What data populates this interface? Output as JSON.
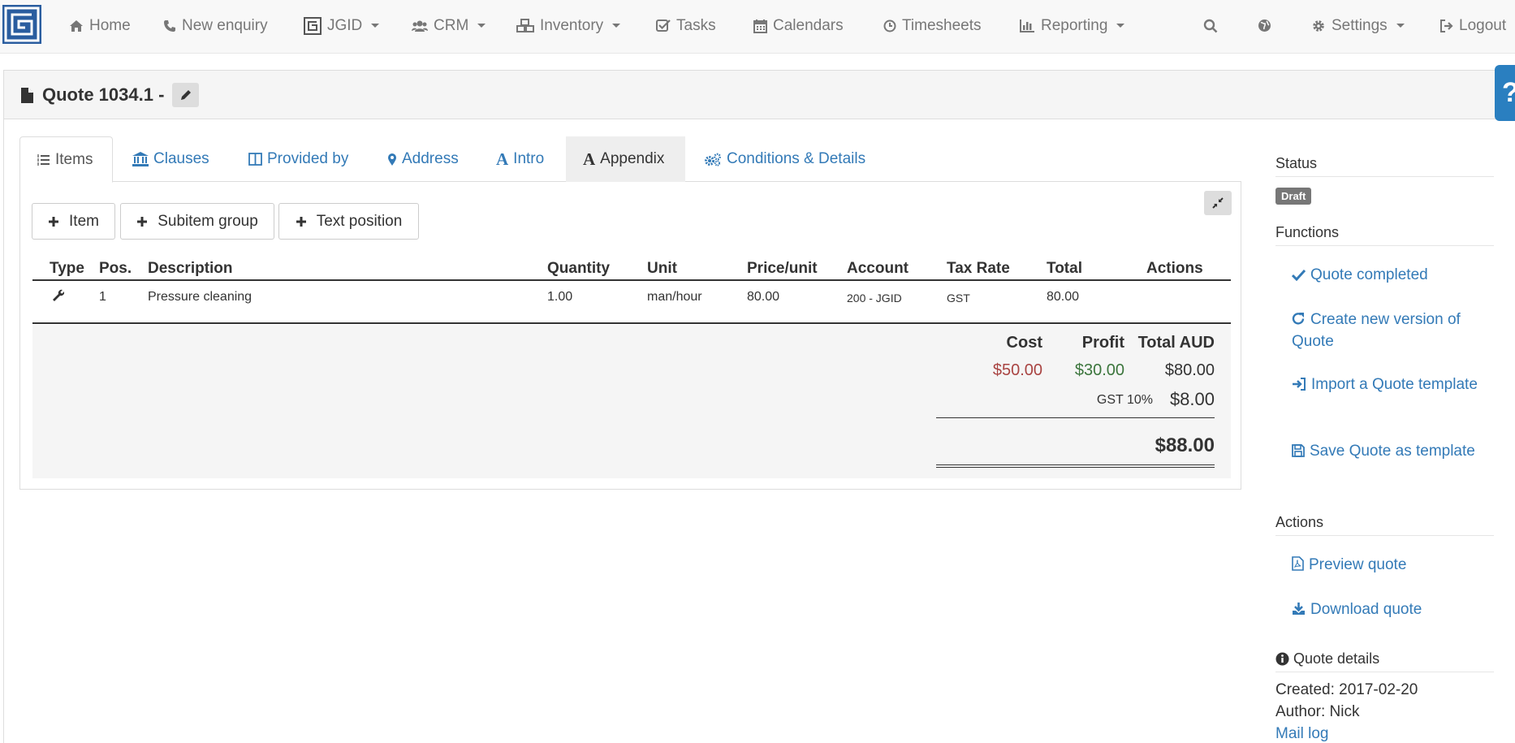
{
  "nav": {
    "home": "Home",
    "new_enquiry": "New enquiry",
    "jgid": "JGID",
    "crm": "CRM",
    "inventory": "Inventory",
    "tasks": "Tasks",
    "calendars": "Calendars",
    "timesheets": "Timesheets",
    "reporting": "Reporting",
    "settings": "Settings",
    "logout": "Logout"
  },
  "page": {
    "title": "Quote 1034.1 -",
    "help_glyph": "?"
  },
  "tabs": [
    "Items",
    "Clauses",
    "Provided by",
    "Address",
    "Intro",
    "Appendix",
    "Conditions & Details"
  ],
  "buttons": {
    "item": "Item",
    "subitem_group": "Subitem group",
    "text_position": "Text position"
  },
  "table": {
    "headers": [
      "Type",
      "Pos.",
      "Description",
      "Quantity",
      "Unit",
      "Price/unit",
      "Account",
      "Tax Rate",
      "Total",
      "Actions"
    ],
    "rows": [
      {
        "type_icon": "wrench-icon",
        "pos": "1",
        "description": "Pressure cleaning",
        "quantity": "1.00",
        "unit": "man/hour",
        "price_unit": "80.00",
        "account": "200 - JGID",
        "tax_rate": "GST",
        "total": "80.00"
      }
    ]
  },
  "totals": {
    "cost_label": "Cost",
    "profit_label": "Profit",
    "total_label": "Total AUD",
    "cost": "$50.00",
    "profit": "$30.00",
    "total": "$80.00",
    "gst_label": "GST 10%",
    "gst": "$8.00",
    "grand_total": "$88.00",
    "cost_color": "#a94442",
    "profit_color": "#3c763d"
  },
  "sidebar": {
    "status_heading": "Status",
    "status_badge": "Draft",
    "functions_heading": "Functions",
    "functions": [
      "Quote completed",
      "Create new version of Quote",
      "Import a Quote template",
      "Save Quote as template"
    ],
    "actions_heading": "Actions",
    "actions": [
      "Preview quote",
      "Download quote"
    ],
    "details_heading": "Quote details",
    "created": "Created: 2017-02-20",
    "author": "Author: Nick",
    "mail_log": "Mail log"
  },
  "colors": {
    "brand": "#2a5d9f",
    "link": "#337ab7",
    "help_tab": "#2a7fc0"
  }
}
